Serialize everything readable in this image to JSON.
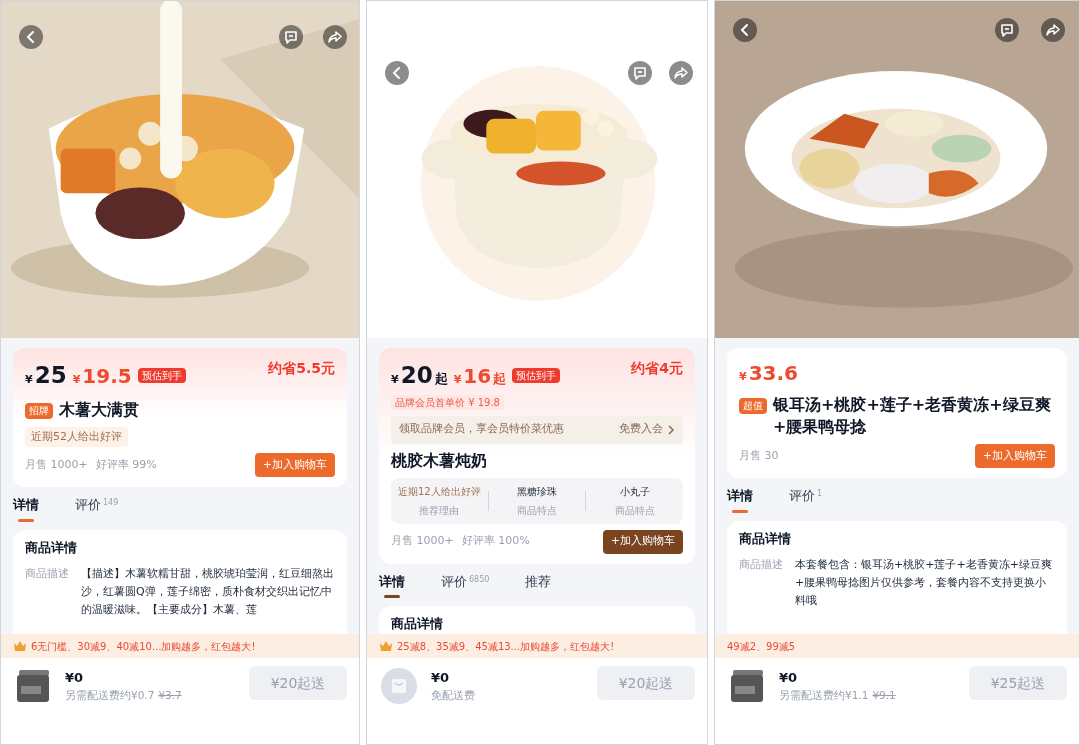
{
  "panels": [
    {
      "card": {
        "tinted": true,
        "prices": [
          {
            "kind": "regular",
            "currency": "¥",
            "amount": "25"
          },
          {
            "kind": "promo",
            "currency": "¥",
            "amount": "19.5"
          }
        ],
        "price_tag": "预估到手",
        "saving": "约省5.5元",
        "badge": "招牌",
        "title": "木薯大满贯",
        "review_chip": "近期52人给出好评",
        "stats": [
          "月售 1000+",
          "好评率 99%"
        ],
        "cart_button": {
          "label": "+加入购物车",
          "color": "#ec6a2c"
        }
      },
      "tabs": [
        {
          "label": "详情",
          "selected": true
        },
        {
          "label": "评价",
          "count": "149",
          "selected": false
        }
      ],
      "detail": {
        "heading": "商品详情",
        "rows": [
          {
            "label": "商品描述",
            "value": "【描述】木薯软糯甘甜，桃胶琥珀莹润，红豆细熬出沙，红薯圆Q弹，莲子绵密，质朴食材交织出记忆中的温暖滋味。【主要成分】木薯、莲"
          }
        ]
      },
      "promo": {
        "crown": true,
        "text": "6无门槛、30减9、40减10...加购越多，红包越大!"
      },
      "footer": {
        "kind": "box",
        "amount": "¥0",
        "note": "另需配送费约¥0.7",
        "note_struck": "¥3.7",
        "button": "¥20起送"
      }
    },
    {
      "card": {
        "tinted": true,
        "prices": [
          {
            "kind": "regular",
            "currency": "¥",
            "amount": "20",
            "suffix": "起"
          },
          {
            "kind": "promo",
            "currency": "¥",
            "amount": "16",
            "suffix": "起"
          }
        ],
        "price_tag": "预估到手",
        "saving": "约省4元",
        "member_price": "品牌会员首单价 ¥ 19.8",
        "member_banner": {
          "text": "领取品牌会员，享会员特价菜优惠",
          "action": "免费入会"
        },
        "title": "桃胶木薯炖奶",
        "features": [
          {
            "value": "近期12人给出好评",
            "label": "推荐理由",
            "highlight": true
          },
          {
            "value": "黑糖珍珠",
            "label": "商品特点",
            "highlight": false
          },
          {
            "value": "小丸子",
            "label": "商品特点",
            "highlight": false
          }
        ],
        "stats": [
          "月售 1000+",
          "好评率 100%"
        ],
        "cart_button": {
          "label": "+加入购物车",
          "color": "#7a4420"
        }
      },
      "tabs": [
        {
          "label": "详情",
          "selected": true
        },
        {
          "label": "评价",
          "count": "6850",
          "selected": false
        },
        {
          "label": "推荐",
          "selected": false
        }
      ],
      "detail": {
        "heading": "商品详情"
      },
      "promo": {
        "crown": true,
        "text": "25减8、35减9、45减13...加购越多，红包越大!"
      },
      "footer": {
        "kind": "bag",
        "amount": "¥0",
        "note": "免配送费",
        "button": "¥20起送"
      }
    },
    {
      "card": {
        "tinted": false,
        "prices": [
          {
            "kind": "promo",
            "currency": "¥",
            "amount": "33.6"
          }
        ],
        "badge": "超值",
        "title": "银耳汤+桃胶+莲子+老香黄冻+绿豆爽+腰果鸭母捻",
        "stats": [
          "月售 30"
        ],
        "cart_button": {
          "label": "+加入购物车",
          "color": "#ec6a2c"
        }
      },
      "tabs": [
        {
          "label": "详情",
          "selected": true
        },
        {
          "label": "评价",
          "count": "1",
          "selected": false
        }
      ],
      "detail": {
        "heading": "商品详情",
        "rows": [
          {
            "label": "商品描述",
            "value": "本套餐包含：银耳汤+桃胶+莲子+老香黄冻+绿豆爽+腰果鸭母捻图片仅供参考，套餐内容不支持更换小料哦"
          }
        ]
      },
      "promo": {
        "crown": false,
        "text": "49减2、99减5"
      },
      "footer": {
        "kind": "box",
        "amount": "¥0",
        "note": "另需配送费约¥1.1",
        "note_struck": "¥9.1",
        "button": "¥25起送"
      }
    }
  ]
}
